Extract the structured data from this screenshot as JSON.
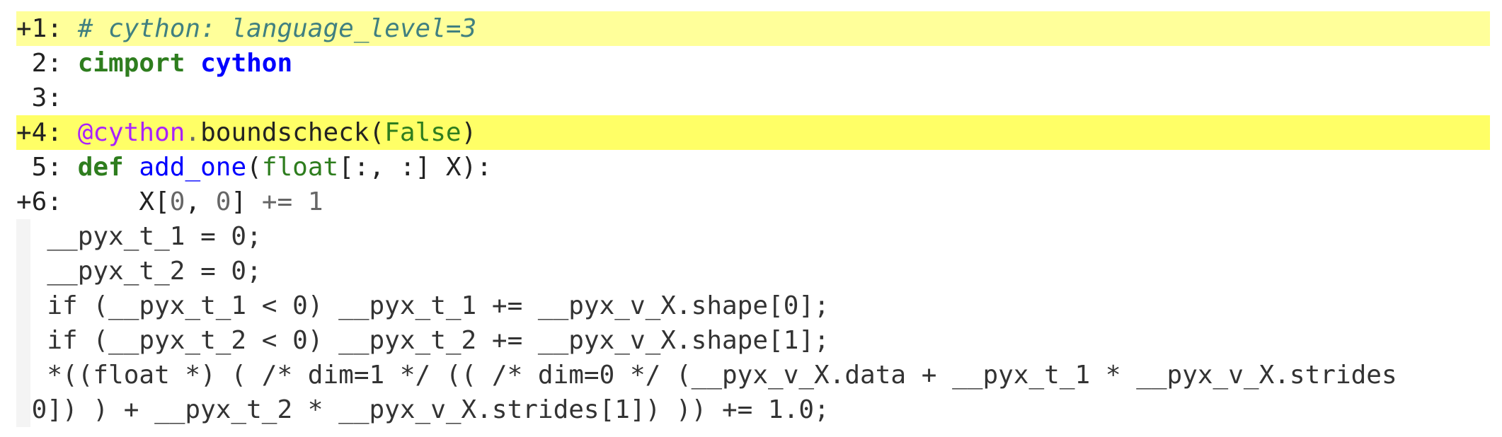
{
  "annotated_source": {
    "lines": [
      {
        "prefix": "+1: ",
        "highlight": "#ffff9a",
        "tokens": [
          {
            "text": "# cython: language_level=3",
            "cls": "k-comment"
          }
        ]
      },
      {
        "prefix": " 2: ",
        "highlight": "#ffffff",
        "tokens": [
          {
            "text": "cimport",
            "cls": "k-keyword"
          },
          {
            "text": " ",
            "cls": "k-plain"
          },
          {
            "text": "cython",
            "cls": "k-module"
          }
        ]
      },
      {
        "prefix": " 3: ",
        "highlight": "#ffffff",
        "tokens": []
      },
      {
        "prefix": "+4: ",
        "highlight": "#ffff66",
        "tokens": [
          {
            "text": "@cython",
            "cls": "k-decorator"
          },
          {
            "text": ".",
            "cls": "k-op"
          },
          {
            "text": "boundscheck",
            "cls": "k-plain"
          },
          {
            "text": "(",
            "cls": "k-plain"
          },
          {
            "text": "False",
            "cls": "k-builtin"
          },
          {
            "text": ")",
            "cls": "k-plain"
          }
        ]
      },
      {
        "prefix": " 5: ",
        "highlight": "#ffffff",
        "tokens": [
          {
            "text": "def",
            "cls": "k-keyword"
          },
          {
            "text": " ",
            "cls": "k-plain"
          },
          {
            "text": "add_one",
            "cls": "k-func"
          },
          {
            "text": "(",
            "cls": "k-plain"
          },
          {
            "text": "float",
            "cls": "k-builtin"
          },
          {
            "text": "[:, :] X):",
            "cls": "k-plain"
          }
        ]
      },
      {
        "prefix": "+6: ",
        "highlight": "#ffffff",
        "tokens": [
          {
            "text": "    X[",
            "cls": "k-plain"
          },
          {
            "text": "0",
            "cls": "k-num"
          },
          {
            "text": ", ",
            "cls": "k-plain"
          },
          {
            "text": "0",
            "cls": "k-num"
          },
          {
            "text": "] ",
            "cls": "k-plain"
          },
          {
            "text": "+=",
            "cls": "k-op"
          },
          {
            "text": " ",
            "cls": "k-plain"
          },
          {
            "text": "1",
            "cls": "k-num"
          }
        ]
      }
    ],
    "generated_c": [
      "  __pyx_t_1 = 0;",
      "  __pyx_t_2 = 0;",
      "  if (__pyx_t_1 < 0) __pyx_t_1 += __pyx_v_X.shape[0];",
      "  if (__pyx_t_2 < 0) __pyx_t_2 += __pyx_v_X.shape[1];",
      "  *((float *) ( /* dim=1 */ (( /* dim=0 */ (__pyx_v_X.data + __pyx_t_1 * __pyx_v_X.strides",
      "[0]) ) + __pyx_t_2 * __pyx_v_X.strides[1]) )) += 1.0;"
    ]
  }
}
